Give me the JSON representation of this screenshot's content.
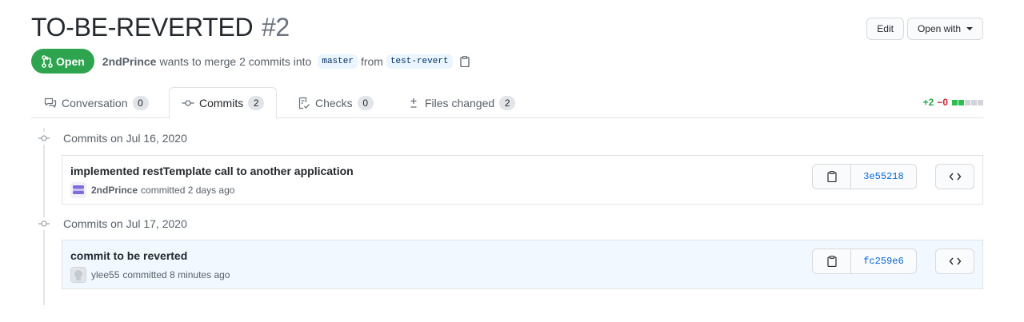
{
  "pr": {
    "title": "TO-BE-REVERTED",
    "number": "#2",
    "state": "Open",
    "author": "2ndPrince",
    "merge_text": "wants to merge 2 commits into",
    "base_branch": "master",
    "from_text": "from",
    "head_branch": "test-revert"
  },
  "actions": {
    "edit_label": "Edit",
    "open_with_label": "Open with"
  },
  "tabs": [
    {
      "label": "Conversation",
      "count": "0",
      "icon": "comment-discussion-icon",
      "selected": false
    },
    {
      "label": "Commits",
      "count": "2",
      "icon": "git-commit-icon",
      "selected": true
    },
    {
      "label": "Checks",
      "count": "0",
      "icon": "checklist-icon",
      "selected": false
    },
    {
      "label": "Files changed",
      "count": "2",
      "icon": "diff-icon",
      "selected": false
    }
  ],
  "diffstat": {
    "additions": "+2",
    "deletions": "−0",
    "blocks_green": 2,
    "blocks_gray": 3
  },
  "commit_groups": [
    {
      "date_label": "Commits on Jul 16, 2020",
      "commits": [
        {
          "message": "implemented restTemplate call to another application",
          "author": "2ndPrince",
          "action": "committed",
          "when": "2 days ago",
          "sha": "3e55218",
          "highlighted": false
        }
      ]
    },
    {
      "date_label": "Commits on Jul 17, 2020",
      "commits": [
        {
          "message": "commit to be reverted",
          "author": "ylee55",
          "action": "committed",
          "when": "8 minutes ago",
          "sha": "fc259e6",
          "highlighted": true
        }
      ]
    }
  ],
  "colors": {
    "open_green": "#2ea44f",
    "link_blue": "#0366d6",
    "highlight_bg": "#f1f8ff"
  }
}
